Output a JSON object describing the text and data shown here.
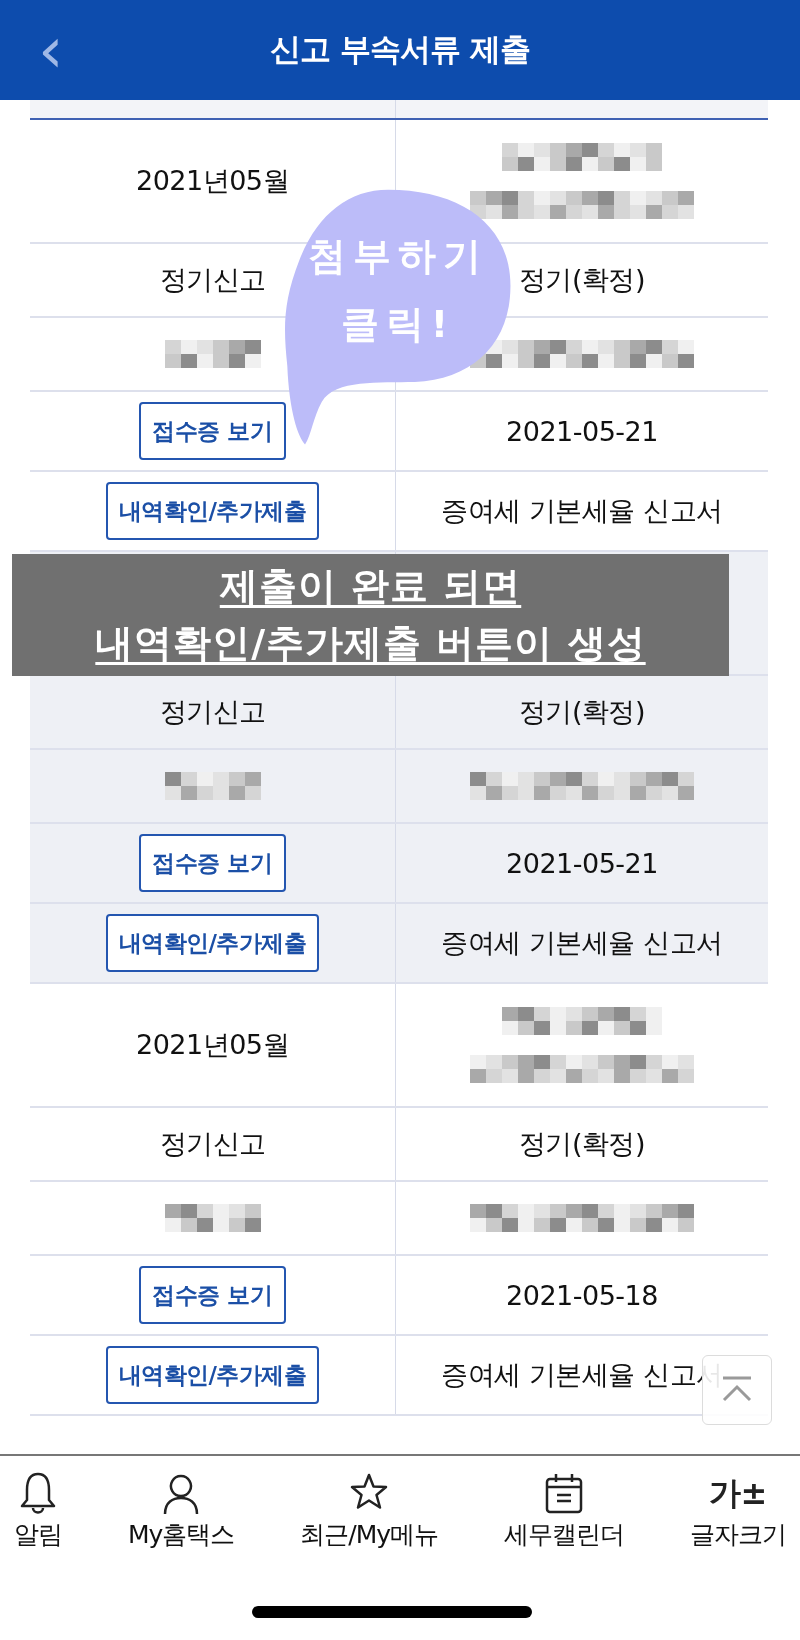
{
  "header": {
    "back": "‹",
    "title": "신고 부속서류 제출"
  },
  "records": [
    {
      "shaded": false,
      "rows": [
        [
          {
            "kind": "text",
            "text": "2021년05월"
          },
          {
            "kind": "redacted-double"
          }
        ],
        [
          {
            "kind": "text",
            "text": "정기신고"
          },
          {
            "kind": "text",
            "text": "정기(확정)"
          }
        ],
        [
          {
            "kind": "redacted"
          },
          {
            "kind": "redacted"
          }
        ],
        [
          {
            "kind": "button",
            "text": "접수증 보기"
          },
          {
            "kind": "text",
            "text": "2021-05-21"
          }
        ],
        [
          {
            "kind": "button",
            "text": "내역확인/추가제출"
          },
          {
            "kind": "text",
            "text": "증여세 기본세율 신고서"
          }
        ]
      ]
    },
    {
      "shaded": true,
      "rows": [
        [
          {
            "kind": "blank"
          },
          {
            "kind": "blank"
          }
        ],
        [
          {
            "kind": "text",
            "text": "정기신고"
          },
          {
            "kind": "text",
            "text": "정기(확정)"
          }
        ],
        [
          {
            "kind": "redacted"
          },
          {
            "kind": "redacted"
          }
        ],
        [
          {
            "kind": "button",
            "text": "접수증 보기"
          },
          {
            "kind": "text",
            "text": "2021-05-21"
          }
        ],
        [
          {
            "kind": "button",
            "text": "내역확인/추가제출"
          },
          {
            "kind": "text",
            "text": "증여세 기본세율 신고서"
          }
        ]
      ]
    },
    {
      "shaded": false,
      "rows": [
        [
          {
            "kind": "text",
            "text": "2021년05월"
          },
          {
            "kind": "redacted-double"
          }
        ],
        [
          {
            "kind": "text",
            "text": "정기신고"
          },
          {
            "kind": "text",
            "text": "정기(확정)"
          }
        ],
        [
          {
            "kind": "redacted"
          },
          {
            "kind": "redacted"
          }
        ],
        [
          {
            "kind": "button",
            "text": "접수증 보기"
          },
          {
            "kind": "text",
            "text": "2021-05-18"
          }
        ],
        [
          {
            "kind": "button",
            "text": "내역확인/추가제출"
          },
          {
            "kind": "text",
            "text": "증여세 기본세율 신고서"
          }
        ]
      ]
    }
  ],
  "callout": {
    "lines": [
      "첨부하기",
      "클릭!"
    ]
  },
  "banner": {
    "lines": [
      "제출이 완료 되면",
      "내역확인/추가제출 버튼이 생성"
    ]
  },
  "nav": [
    {
      "kind": "bell",
      "label": "알림"
    },
    {
      "kind": "person",
      "label": "My홈택스"
    },
    {
      "kind": "star",
      "label": "최근/My메뉴"
    },
    {
      "kind": "calendar",
      "label": "세무캘린더"
    },
    {
      "kind": "glyph",
      "glyph": "가±",
      "label": "글자크기"
    }
  ]
}
